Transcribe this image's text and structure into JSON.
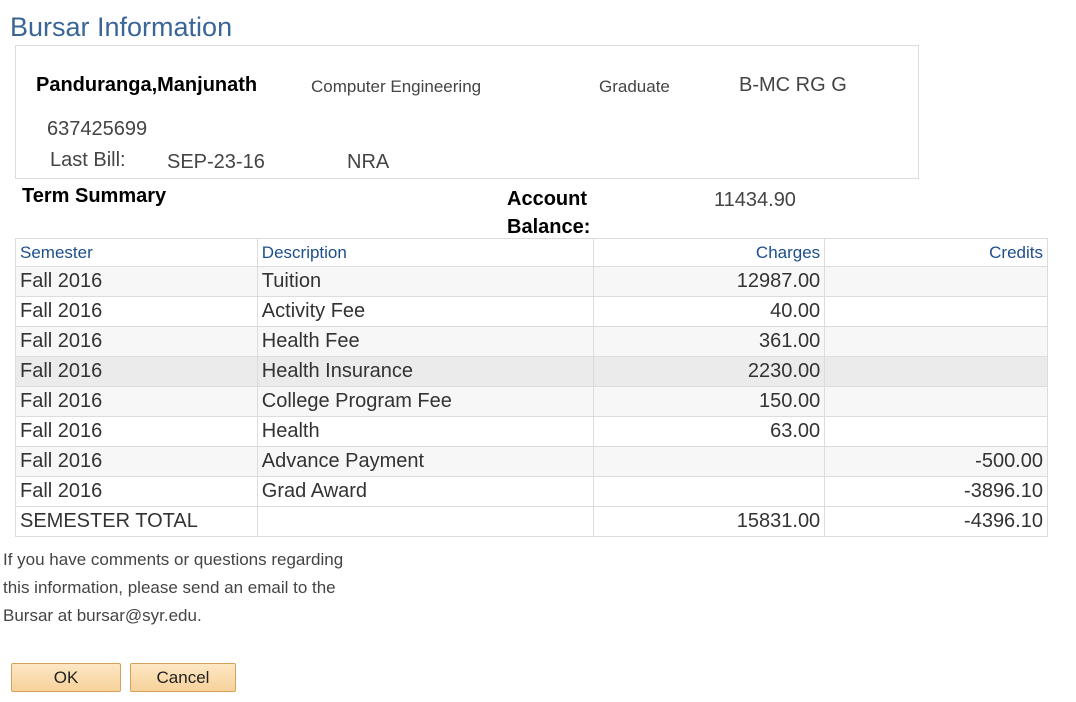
{
  "page": {
    "title": "Bursar Information"
  },
  "student": {
    "name": "Panduranga,Manjunath",
    "program": "Computer Engineering",
    "career": "Graduate",
    "plan": "B-MC RG G",
    "id": "637425699",
    "last_bill_label": "Last Bill:",
    "last_bill_date": "SEP-23-16",
    "residency": "NRA"
  },
  "summary": {
    "term_summary_label": "Term Summary",
    "account_balance_label": "Account Balance:",
    "account_balance_value": "11434.90"
  },
  "table": {
    "headers": {
      "semester": "Semester",
      "description": "Description",
      "charges": "Charges",
      "credits": "Credits"
    },
    "rows": [
      {
        "semester": "Fall 2016",
        "description": "Tuition",
        "charges": "12987.00",
        "credits": ""
      },
      {
        "semester": "Fall 2016",
        "description": "Activity Fee",
        "charges": "40.00",
        "credits": ""
      },
      {
        "semester": "Fall 2016",
        "description": "Health Fee",
        "charges": "361.00",
        "credits": ""
      },
      {
        "semester": "Fall 2016",
        "description": "Health Insurance",
        "charges": "2230.00",
        "credits": ""
      },
      {
        "semester": "Fall 2016",
        "description": "College Program Fee",
        "charges": "150.00",
        "credits": ""
      },
      {
        "semester": "Fall 2016",
        "description": "Health",
        "charges": "63.00",
        "credits": ""
      },
      {
        "semester": "Fall 2016",
        "description": "Advance Payment",
        "charges": "",
        "credits": "-500.00"
      },
      {
        "semester": "Fall 2016",
        "description": "Grad Award",
        "charges": "",
        "credits": "-3896.10"
      },
      {
        "semester": "SEMESTER TOTAL",
        "description": "",
        "charges": "15831.00",
        "credits": "-4396.10"
      }
    ]
  },
  "note": {
    "line1": "If you have comments or questions regarding",
    "line2": "this information, please send an email to the",
    "line3": "Bursar at bursar@syr.edu."
  },
  "buttons": {
    "ok": "OK",
    "cancel": "Cancel"
  },
  "colors": {
    "title": "#3a6597",
    "header_link": "#1c4f8a",
    "button_border": "#d6a25a",
    "button_fill": "#f7d29b"
  }
}
